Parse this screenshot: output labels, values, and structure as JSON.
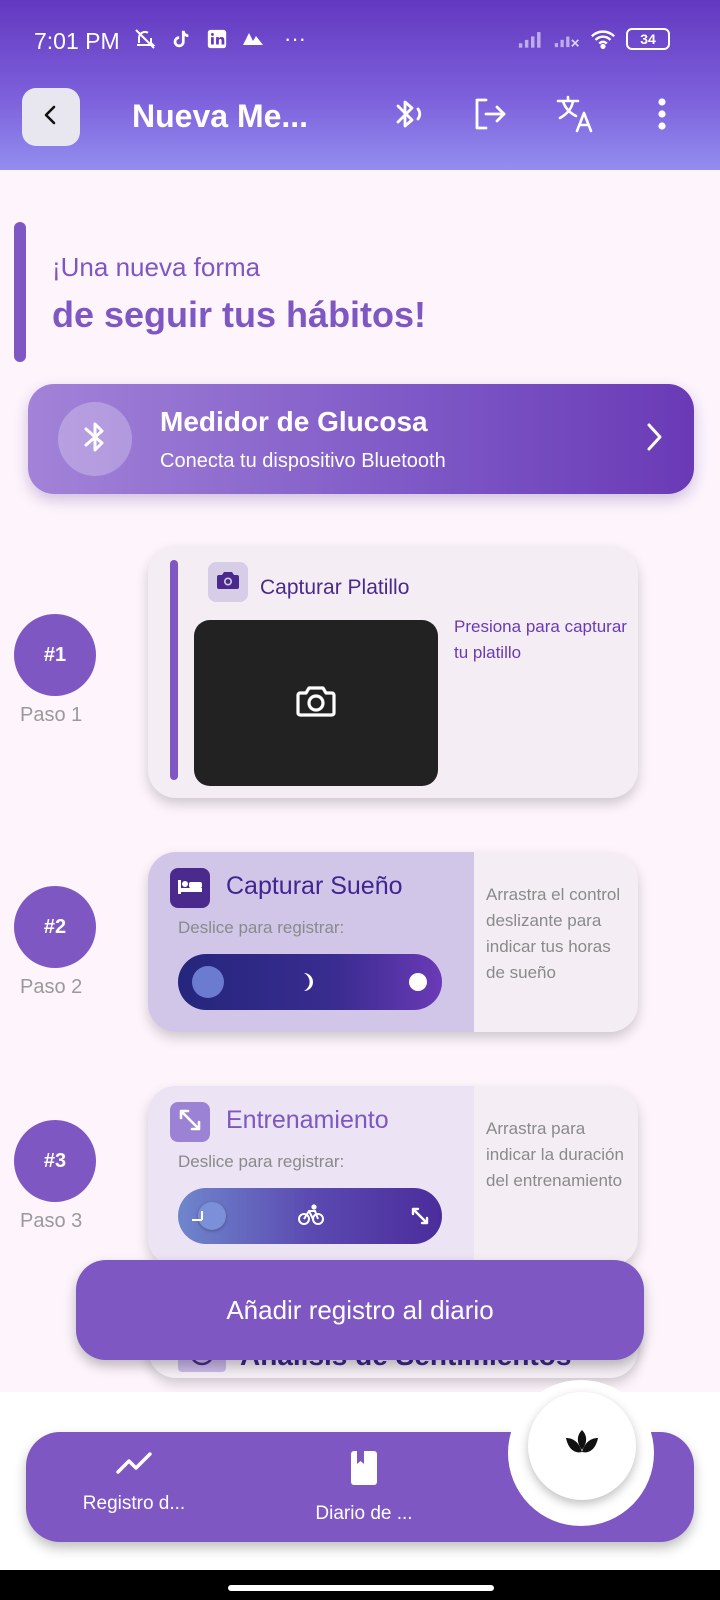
{
  "status_bar": {
    "time": "7:01 PM",
    "dots": "···",
    "battery": "34"
  },
  "app_bar": {
    "title": "Nueva Me...",
    "icons": [
      "back-icon",
      "bluetooth-icon",
      "logout-icon",
      "translate-icon",
      "more-vert-icon"
    ]
  },
  "hero": {
    "line1": "¡Una nueva forma",
    "line2": "de seguir tus hábitos!"
  },
  "glucose": {
    "title": "Medidor de Glucosa",
    "subtitle": "Conecta tu dispositivo Bluetooth"
  },
  "steps": [
    {
      "badge": "#1",
      "label": "Paso 1",
      "title": "Capturar Platillo",
      "hint": "Presiona para capturar tu platillo"
    },
    {
      "badge": "#2",
      "label": "Paso 2",
      "title": "Capturar Sueño",
      "slider_label": "Deslice para registrar:",
      "hint": "Arrastra el control deslizante para indicar tus horas de sueño"
    },
    {
      "badge": "#3",
      "label": "Paso 3",
      "title": "Entrenamiento",
      "slider_label": "Deslice para registrar:",
      "hint": "Arrastra para indicar la duración del entrenamiento"
    },
    {
      "title": "Análisis de Sentimientos"
    }
  ],
  "add_button": "Añadir registro al diario",
  "bottom_nav": {
    "items": [
      {
        "label": "Registro d...",
        "icon": "trending-up-icon"
      },
      {
        "label": "Diario de ...",
        "icon": "book-icon"
      }
    ],
    "fab_icon": "lotus-icon"
  },
  "colors": {
    "primary": "#7e57c2",
    "header_top": "#6338c0",
    "background": "#fdf4fc"
  }
}
